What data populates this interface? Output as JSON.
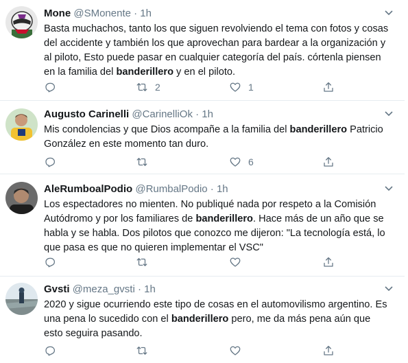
{
  "tweets": [
    {
      "name": "Mone",
      "handle": "@SMonente",
      "separator": "·",
      "time": "1h",
      "text_parts": [
        "Basta muchachos, tanto los que siguen revolviendo el tema con fotos y cosas del accidente y también los que aprovechan para bardear a la organización y al piloto, Esto puede pasar en cualquier categoría del país. córtenla piensen en la familia del ",
        "banderillero",
        " y en el piloto."
      ],
      "replies": "",
      "retweets": "2",
      "likes": "1"
    },
    {
      "name": "Augusto Carinelli",
      "handle": "@CarinelliOk",
      "separator": "·",
      "time": "1h",
      "text_parts": [
        "Mis condolencias y que Dios acompañe a la familia del ",
        "banderillero",
        " Patricio González en este momento tan duro."
      ],
      "replies": "",
      "retweets": "",
      "likes": "6"
    },
    {
      "name": "AleRumboalPodio",
      "handle": "@RumbalPodio",
      "separator": "·",
      "time": "1h",
      "text_parts": [
        "Los espectadores no mienten. No publiqué nada por respeto a la Comisión Autódromo y por los familiares de ",
        "banderillero",
        ". Hace más de un año que se habla y se habla. Dos pilotos que conozco me dijeron: \"La tecnología está, lo que pasa es que no quieren implementar el VSC\""
      ],
      "replies": "",
      "retweets": "",
      "likes": ""
    },
    {
      "name": "Gvsti",
      "handle": "@meza_gvsti",
      "separator": "·",
      "time": "1h",
      "text_parts": [
        "2020 y sigue ocurriendo este tipo de cosas en el automovilismo argentino. Es una pena lo sucedido con el ",
        "banderillero",
        " pero, me da más pena aún que esto seguira pasando."
      ],
      "replies": "",
      "retweets": "",
      "likes": ""
    }
  ],
  "icons": {
    "reply": "reply-icon",
    "retweet": "retweet-icon",
    "like": "like-icon",
    "share": "share-icon",
    "caret": "chevron-down-icon"
  },
  "colors": {
    "text": "#14171a",
    "muted": "#657786",
    "divider": "#e6ecf0"
  }
}
